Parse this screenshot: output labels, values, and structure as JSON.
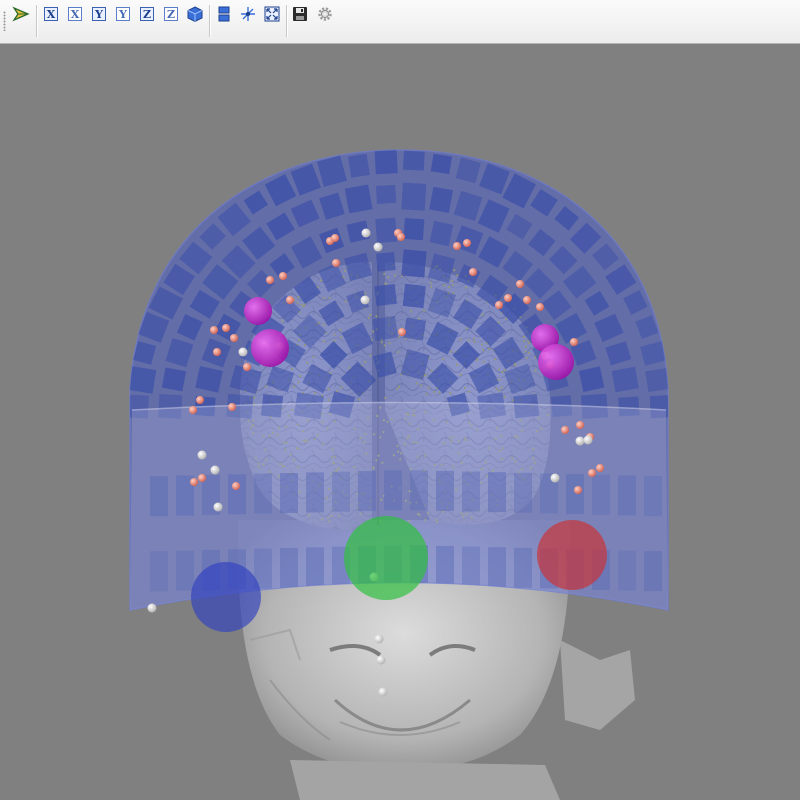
{
  "toolbar": {
    "buttons": [
      {
        "name": "select-tool",
        "icon": "pointer-arrow-icon"
      },
      {
        "name": "view-x-button",
        "label": "X",
        "icon": "view-x-icon"
      },
      {
        "name": "view-x-inverse-button",
        "label": "X",
        "icon": "view-x-inverse-icon"
      },
      {
        "name": "view-y-button",
        "label": "Y",
        "icon": "view-y-icon"
      },
      {
        "name": "view-y-inverse-button",
        "label": "Y",
        "icon": "view-y-inverse-icon"
      },
      {
        "name": "view-z-button",
        "label": "Z",
        "icon": "view-z-icon"
      },
      {
        "name": "view-z-inverse-button",
        "label": "Z",
        "icon": "view-z-inverse-icon"
      },
      {
        "name": "view-iso-button",
        "icon": "iso-cube-icon"
      },
      {
        "name": "layout-button",
        "icon": "split-view-icon"
      },
      {
        "name": "center-view-button",
        "icon": "axes-icon"
      },
      {
        "name": "fit-view-button",
        "icon": "fullscreen-icon"
      },
      {
        "name": "save-button",
        "icon": "floppy-disk-icon"
      },
      {
        "name": "settings-button",
        "icon": "gear-icon"
      }
    ]
  },
  "scene": {
    "background_color": "#808080",
    "helmet_color": "#4a5cc8",
    "sensor_color": "#3a4ea8",
    "brain_color": "#d2d0c2",
    "head_color": "#c8c8c8",
    "source_dot_color": "#e8e020",
    "electrode_color": "#e8806e",
    "marker_colors": {
      "magenta": "#c020c8",
      "green": "#30c040",
      "red": "#d03030",
      "blue": "#3040c0"
    }
  }
}
